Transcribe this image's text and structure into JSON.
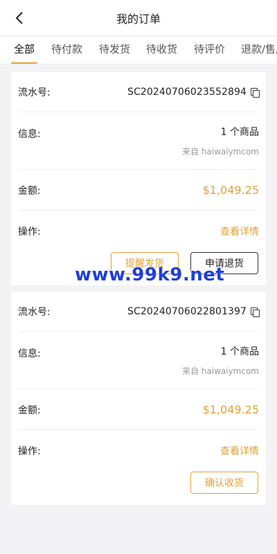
{
  "header": {
    "title": "我的订单"
  },
  "tabs": [
    {
      "label": "全部",
      "active": true
    },
    {
      "label": "待付款"
    },
    {
      "label": "待发货"
    },
    {
      "label": "待收货"
    },
    {
      "label": "待评价"
    },
    {
      "label": "退款/售后"
    }
  ],
  "orders": [
    {
      "serial_label": "流水号:",
      "serial": "SC20240706023552894",
      "info_label": "信息:",
      "item_count": "1 个商品",
      "source": "来自 haiwaiymcom",
      "amount_label": "金额:",
      "amount": "$1,049.25",
      "ops_label": "操作:",
      "detail_link": "查看详情",
      "buttons": [
        "提醒发货",
        "申请退货"
      ]
    },
    {
      "serial_label": "流水号:",
      "serial": "SC20240706022801397",
      "info_label": "信息:",
      "item_count": "1 个商品",
      "source": "来自 haiwaiymcom",
      "amount_label": "金额:",
      "amount": "$1,049.25",
      "ops_label": "操作:",
      "detail_link": "查看详情",
      "buttons": [
        "确认收货"
      ]
    }
  ],
  "watermark": "www.99k9.net",
  "colors": {
    "accent": "#e0a136",
    "watermark": "#1f3fd8"
  },
  "icons": {
    "back": "chevron-left-icon",
    "copy": "copy-icon"
  }
}
